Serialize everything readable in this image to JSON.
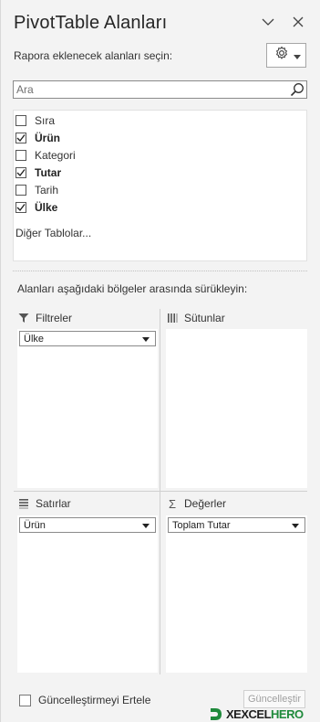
{
  "header": {
    "title": "PivotTable Alanları",
    "collapse_icon": "chevron-down-icon",
    "close_icon": "close-icon"
  },
  "chooser": {
    "label": "Rapora eklenecek alanları seçin:",
    "tools_icon": "gear-icon"
  },
  "search": {
    "placeholder": "Ara",
    "icon": "search-icon"
  },
  "fields": [
    {
      "label": "Sıra",
      "checked": false
    },
    {
      "label": "Ürün",
      "checked": true
    },
    {
      "label": "Kategori",
      "checked": false
    },
    {
      "label": "Tutar",
      "checked": true
    },
    {
      "label": "Tarih",
      "checked": false
    },
    {
      "label": "Ülke",
      "checked": true
    }
  ],
  "more_tables": "Diğer Tablolar...",
  "drag_hint": "Alanları aşağıdaki bölgeler arasında sürükleyin:",
  "areas": {
    "filters": {
      "label": "Filtreler",
      "icon": "filter-icon",
      "items": [
        "Ülke"
      ]
    },
    "columns": {
      "label": "Sütunlar",
      "icon": "columns-icon",
      "items": []
    },
    "rows": {
      "label": "Satırlar",
      "icon": "rows-icon",
      "items": [
        "Ürün"
      ]
    },
    "values": {
      "label": "Değerler",
      "icon": "sigma-icon",
      "items": [
        "Toplam Tutar"
      ]
    }
  },
  "footer": {
    "defer_label": "Güncelleştirmeyi Ertele",
    "defer_checked": false,
    "update_label": "Güncelleştir"
  },
  "watermark": {
    "text_dark": "XEXCEL",
    "text_green": "HERO"
  },
  "colors": {
    "panel_bg": "#f3f3f3",
    "accent_green": "#1f8a3b",
    "border": "#8a8a8a"
  }
}
